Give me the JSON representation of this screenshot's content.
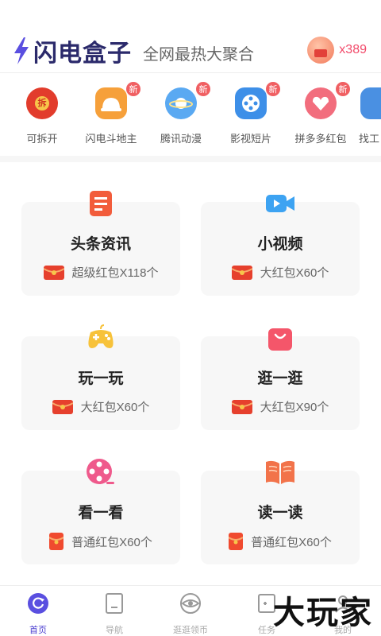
{
  "header": {
    "logo_text": "闪电盒子",
    "tagline": "全网最热大聚合",
    "coin_count": "x389"
  },
  "apps": [
    {
      "label": "可拆开",
      "icon": "red-envelope-open-icon",
      "new": false,
      "badge_text": ""
    },
    {
      "label": "闪电斗地主",
      "icon": "helmet-icon",
      "new": true,
      "badge_text": "新"
    },
    {
      "label": "腾讯动漫",
      "icon": "planet-icon",
      "new": true,
      "badge_text": "新"
    },
    {
      "label": "影视短片",
      "icon": "film-reel-icon",
      "new": true,
      "badge_text": "新"
    },
    {
      "label": "拼多多红包",
      "icon": "gift-heart-icon",
      "new": true,
      "badge_text": "新"
    },
    {
      "label": "找工",
      "icon": "briefcase-icon",
      "new": false,
      "badge_text": ""
    }
  ],
  "cards": [
    {
      "title": "头条资讯",
      "reward": "超级红包X118个",
      "icon": "news-icon"
    },
    {
      "title": "小视频",
      "reward": "大红包X60个",
      "icon": "video-camera-icon"
    },
    {
      "title": "玩一玩",
      "reward": "大红包X60个",
      "icon": "gamepad-icon"
    },
    {
      "title": "逛一逛",
      "reward": "大红包X90个",
      "icon": "shopping-bag-icon"
    },
    {
      "title": "看一看",
      "reward": "普通红包X60个",
      "icon": "film-reel-icon"
    },
    {
      "title": "读一读",
      "reward": "普通红包X60个",
      "icon": "open-book-icon"
    }
  ],
  "nav": [
    {
      "label": "首页",
      "icon": "home-refresh-icon",
      "active": true
    },
    {
      "label": "导航",
      "icon": "nav-square-icon",
      "active": false
    },
    {
      "label": "逛逛领币",
      "icon": "eye-icon",
      "active": false
    },
    {
      "label": "任务",
      "icon": "task-icon",
      "active": false
    },
    {
      "label": "我的",
      "icon": "profile-icon",
      "active": false
    }
  ],
  "watermark": "大玩家",
  "colors": {
    "brand": "#2b2a6b",
    "accent": "#f24a6a",
    "active_nav": "#4b3fd0",
    "badge": "#f05f62"
  }
}
